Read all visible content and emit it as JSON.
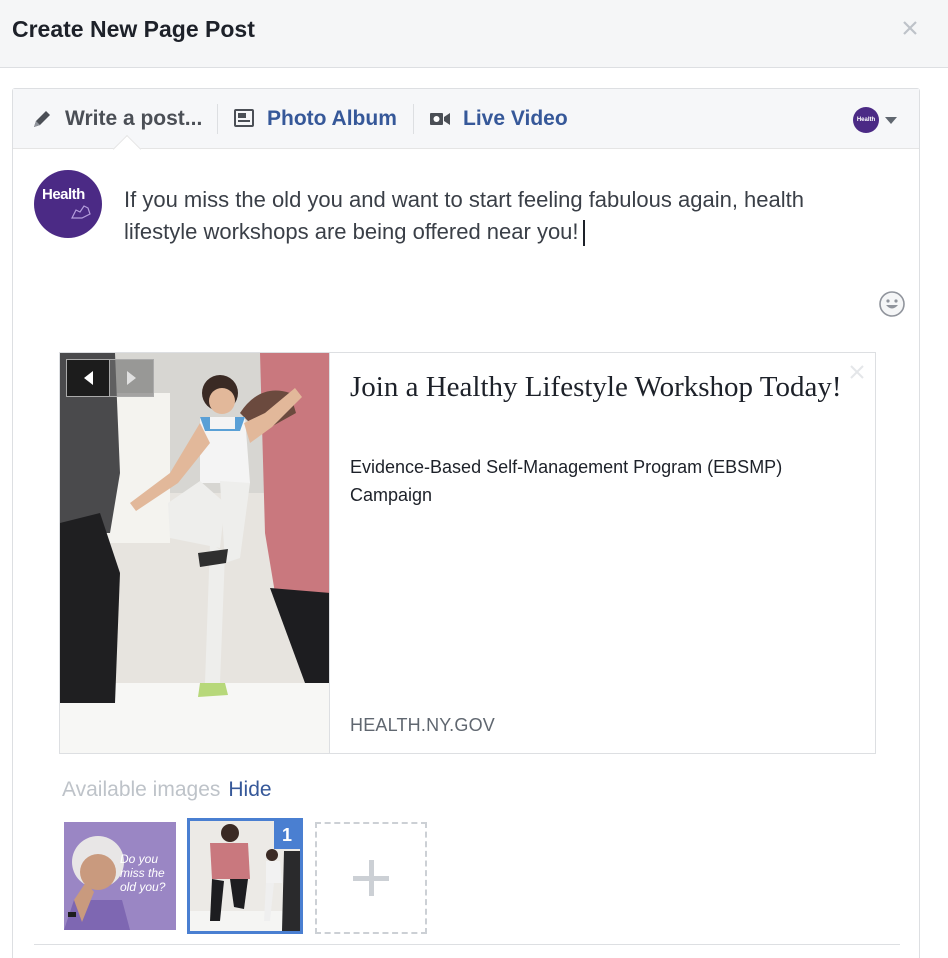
{
  "dialog": {
    "title": "Create New Page Post"
  },
  "tabs": {
    "write": "Write a post...",
    "photo_album": "Photo Album",
    "live_video": "Live Video"
  },
  "page_avatar": {
    "label": "Health"
  },
  "post": {
    "text": "If you miss the old you and want to start feeling fabulous again, health lifestyle workshops are being offered near you!"
  },
  "link_card": {
    "title": "Join a Healthy Lifestyle Workshop Today!",
    "description": "Evidence-Based Self-Management Program (EBSMP) Campaign",
    "domain": "HEALTH.NY.GOV"
  },
  "available_images": {
    "label": "Available images",
    "hide_label": "Hide",
    "thumbs": [
      {
        "overlay_text": "Do you miss the old you?"
      },
      {
        "badge": "1"
      }
    ]
  },
  "colors": {
    "brand_purple": "#4b2a85",
    "link_blue": "#365899",
    "selection_blue": "#4a7fd1"
  }
}
